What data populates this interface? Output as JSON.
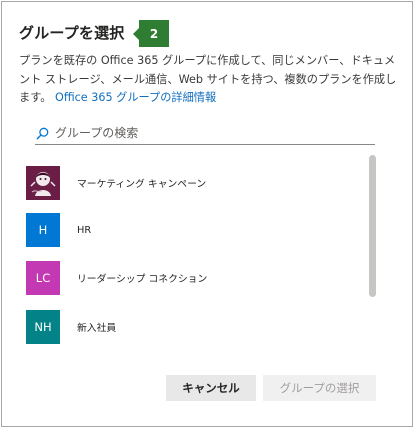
{
  "dialog": {
    "title": "グループを選択",
    "step_number": "2",
    "description_text": "プランを既存の Office 365 グループに作成して、同じメンバー、ドキュメント ストレージ、メール通信、Web サイトを持つ、複数のプランを作成します。",
    "description_link": "Office 365 グループの詳細情報"
  },
  "search": {
    "placeholder": "グループの検索",
    "value": "",
    "icon": "search-icon"
  },
  "groups": [
    {
      "label": "マーケティング キャンペーン",
      "avatar_text": "",
      "avatar_color": "#6b1e45",
      "avatar_type": "image"
    },
    {
      "label": "HR",
      "avatar_text": "H",
      "avatar_color": "#0078d4",
      "avatar_type": "initials"
    },
    {
      "label": "リーダーシップ コネクション",
      "avatar_text": "LC",
      "avatar_color": "#c239b3",
      "avatar_type": "initials"
    },
    {
      "label": "新入社員",
      "avatar_text": "NH",
      "avatar_color": "#038387",
      "avatar_type": "initials"
    }
  ],
  "buttons": {
    "cancel_label": "キャンセル",
    "select_label": "グループの選択"
  },
  "colors": {
    "accent_link": "#106ebe",
    "step_badge": "#2e7d32"
  }
}
